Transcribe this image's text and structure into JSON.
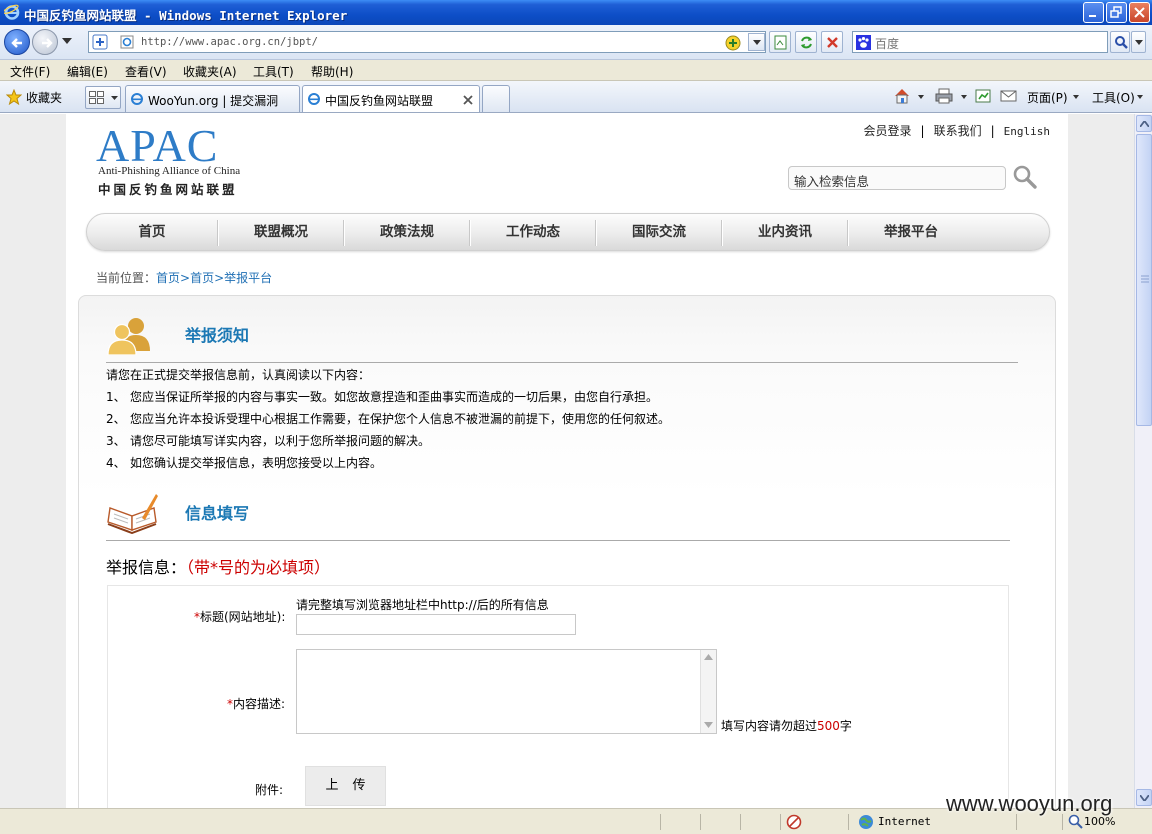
{
  "window": {
    "title": "中国反钓鱼网站联盟 - Windows Internet Explorer"
  },
  "address_bar": {
    "url": "http://www.apac.org.cn/jbpt/",
    "search_placeholder": "百度"
  },
  "menu": [
    "文件(F)",
    "编辑(E)",
    "查看(V)",
    "收藏夹(A)",
    "工具(T)",
    "帮助(H)"
  ],
  "favorites_label": "收藏夹",
  "tabs": [
    {
      "label": "WooYun.org | 提交漏洞"
    },
    {
      "label": "中国反钓鱼网站联盟"
    }
  ],
  "command_bar": {
    "page": "页面(P)",
    "tools": "工具(O)"
  },
  "site": {
    "logo_text": "APAC",
    "logo_en": "Anti-Phishing Alliance of China",
    "logo_cn": "中国反钓鱼网站联盟",
    "top_links": [
      "会员登录",
      "联系我们",
      "English"
    ],
    "search_placeholder": "输入检索信息",
    "nav": [
      "首页",
      "联盟概况",
      "政策法规",
      "工作动态",
      "国际交流",
      "业内资讯",
      "举报平台"
    ],
    "breadcrumb": {
      "label": "当前位置：",
      "items": [
        "首页",
        ">首页",
        ">举报平台"
      ]
    }
  },
  "notice": {
    "title": "举报须知",
    "intro": "请您在正式提交举报信息前，认真阅读以下内容：",
    "items": [
      {
        "num": "1、",
        "text": "您应当保证所举报的内容与事实一致。如您故意捏造和歪曲事实而造成的一切后果，由您自行承担。"
      },
      {
        "num": "2、",
        "text": "您应当允许本投诉受理中心根据工作需要，在保护您个人信息不被泄漏的前提下，使用您的任何叙述。"
      },
      {
        "num": "3、",
        "text": "请您尽可能填写详实内容，以利于您所举报问题的解决。"
      },
      {
        "num": "4、",
        "text": "如您确认提交举报信息，表明您接受以上内容。"
      }
    ]
  },
  "form": {
    "section_title": "信息填写",
    "heading": "举报信息：",
    "heading_note": "（带*号的为必填项）",
    "title_label": "标题(网站地址):",
    "title_hint": "请完整填写浏览器地址栏中http://后的所有信息",
    "content_label": "内容描述:",
    "content_hint_pre": "填写内容请勿超过",
    "content_limit": "500",
    "content_hint_post": "字",
    "attach_label": "附件:",
    "upload_label": "上传",
    "required_mark": "*"
  },
  "status_bar": {
    "zone": "Internet",
    "zoom": "100%"
  },
  "watermark": "www.wooyun.org",
  "colors": {
    "accent": "#1b78b4",
    "logo": "#2e7cc7",
    "required": "#cc0000",
    "ie_title": "#0d4ec7"
  }
}
